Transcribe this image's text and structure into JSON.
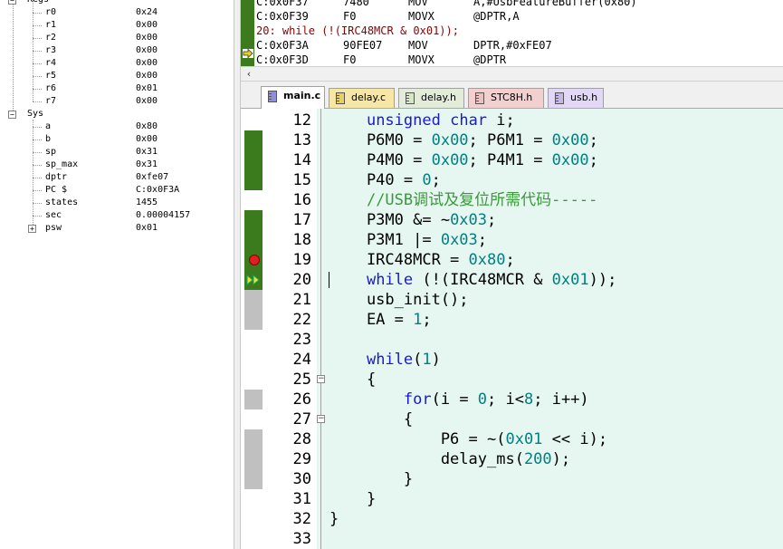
{
  "registers": {
    "regs_label": "Regs",
    "regs": [
      {
        "name": "r0",
        "value": "0x24"
      },
      {
        "name": "r1",
        "value": "0x00"
      },
      {
        "name": "r2",
        "value": "0x00"
      },
      {
        "name": "r3",
        "value": "0x00"
      },
      {
        "name": "r4",
        "value": "0x00"
      },
      {
        "name": "r5",
        "value": "0x00"
      },
      {
        "name": "r6",
        "value": "0x01"
      },
      {
        "name": "r7",
        "value": "0x00"
      }
    ],
    "sys_label": "Sys",
    "sys": [
      {
        "name": "a",
        "value": "0x80"
      },
      {
        "name": "b",
        "value": "0x00"
      },
      {
        "name": "sp",
        "value": "0x31"
      },
      {
        "name": "sp_max",
        "value": "0x31"
      },
      {
        "name": "dptr",
        "value": "0xfe07"
      },
      {
        "name": "PC  $",
        "value": "C:0x0F3A"
      },
      {
        "name": "states",
        "value": "1455"
      },
      {
        "name": "sec",
        "value": "0.00004157"
      },
      {
        "name": "psw",
        "value": "0x01"
      }
    ]
  },
  "disassembly": [
    {
      "addr": "C:0x0F37",
      "bytes": "7480",
      "mnem": "MOV",
      "operands": "A,#UsbFeatureBuffer(0x80)"
    },
    {
      "addr": "C:0x0F39",
      "bytes": "F0",
      "mnem": "MOVX",
      "operands": "@DPTR,A"
    },
    {
      "src": "    20:      while (!(IRC48MCR & 0x01));"
    },
    {
      "addr": "C:0x0F3A",
      "bytes": "90FE07",
      "mnem": "MOV",
      "operands": "DPTR,#0xFE07"
    },
    {
      "addr": "C:0x0F3D",
      "bytes": "F0",
      "mnem": "MOVX",
      "operands": "@DPTR"
    }
  ],
  "tabs": [
    {
      "label": "main.c",
      "type": "c",
      "active": true
    },
    {
      "label": "delay.c",
      "type": "c"
    },
    {
      "label": "delay.h",
      "type": "h"
    },
    {
      "label": "STC8H.h",
      "type": "h"
    },
    {
      "label": "usb.h",
      "type": "h"
    }
  ],
  "editor": {
    "lines": [
      {
        "num": "12",
        "code": "    unsigned char i;",
        "marker": "none"
      },
      {
        "num": "13",
        "code": "    P6M0 = 0x00; P6M1 = 0x00;",
        "marker": "exec"
      },
      {
        "num": "14",
        "code": "    P4M0 = 0x00; P4M1 = 0x00;",
        "marker": "exec"
      },
      {
        "num": "15",
        "code": "    P40 = 0;",
        "marker": "exec"
      },
      {
        "num": "16",
        "code": "    //USB调试及复位所需代码-----",
        "marker": "none"
      },
      {
        "num": "17",
        "code": "    P3M0 &= ~0x03;",
        "marker": "exec"
      },
      {
        "num": "18",
        "code": "    P3M1 |= 0x03;",
        "marker": "exec"
      },
      {
        "num": "19",
        "code": "    IRC48MCR = 0x80;",
        "marker": "breakpoint"
      },
      {
        "num": "20",
        "code": "    while (!(IRC48MCR & 0x01));",
        "marker": "pc"
      },
      {
        "num": "21",
        "code": "    usb_init();",
        "marker": "gray"
      },
      {
        "num": "22",
        "code": "    EA = 1;",
        "marker": "gray"
      },
      {
        "num": "23",
        "code": "",
        "marker": "none"
      },
      {
        "num": "24",
        "code": "    while(1)",
        "marker": "none"
      },
      {
        "num": "25",
        "code": "    {",
        "marker": "none",
        "fold": "-"
      },
      {
        "num": "26",
        "code": "        for(i = 0; i<8; i++)",
        "marker": "gray"
      },
      {
        "num": "27",
        "code": "        {",
        "marker": "none",
        "fold": "-"
      },
      {
        "num": "28",
        "code": "            P6 = ~(0x01 << i);",
        "marker": "gray"
      },
      {
        "num": "29",
        "code": "            delay_ms(200);",
        "marker": "gray"
      },
      {
        "num": "30",
        "code": "        }",
        "marker": "gray"
      },
      {
        "num": "31",
        "code": "    }",
        "marker": "none"
      },
      {
        "num": "32",
        "code": "}",
        "marker": "none"
      },
      {
        "num": "33",
        "code": "",
        "marker": "none"
      }
    ]
  },
  "colors": {
    "exec_marker": "#3c7a1e",
    "editor_bg": "#e6f7f2",
    "keyword": "#1a1acc",
    "number": "#008080",
    "comment": "#3a9a3a"
  }
}
